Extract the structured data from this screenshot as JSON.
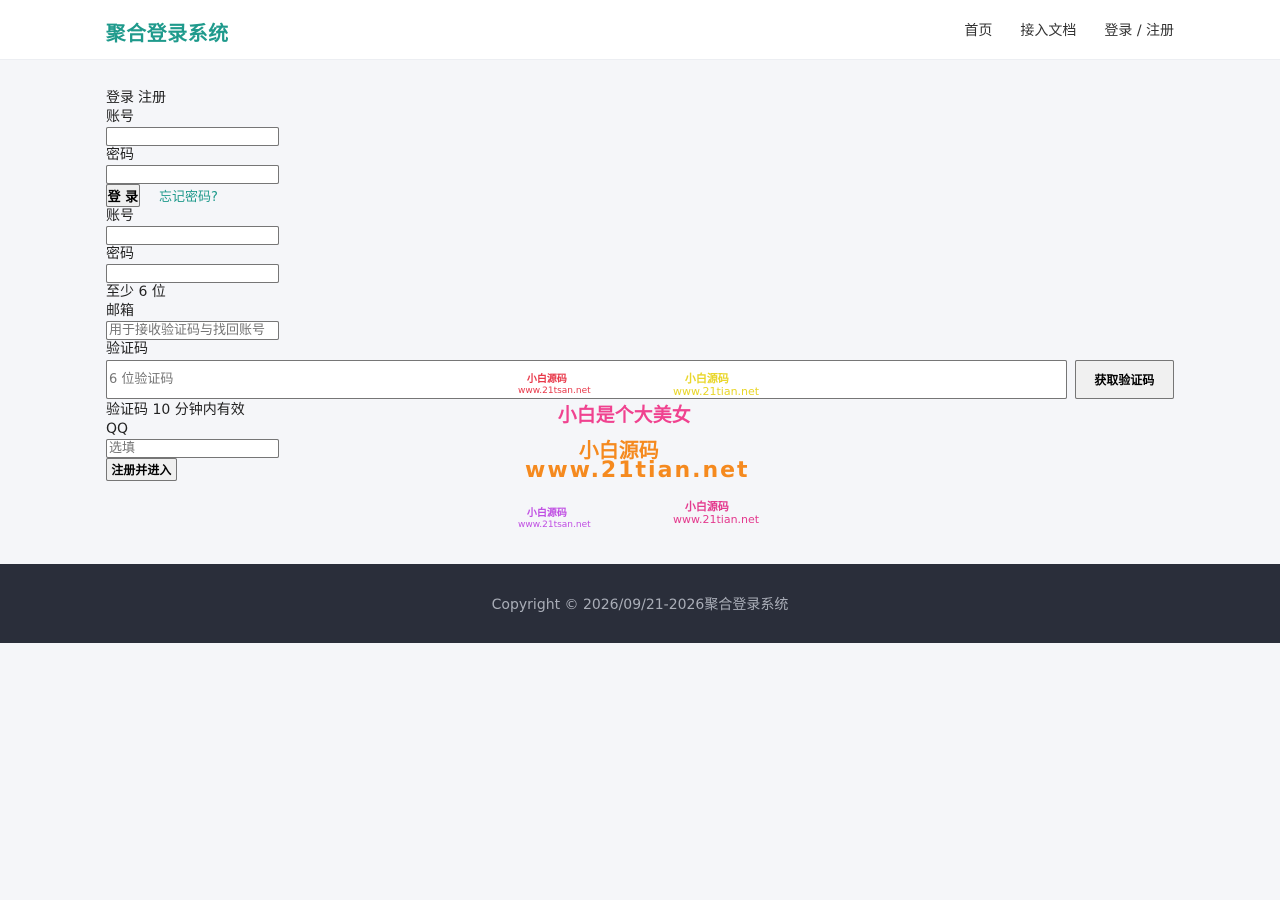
{
  "header": {
    "brand": "聚合登录系统",
    "nav": [
      "首页",
      "接入文档",
      "登录 / 注册"
    ]
  },
  "tabs": {
    "login": "登录",
    "register": "注册"
  },
  "login_form": {
    "account_label": "账号",
    "account_value": "",
    "password_label": "密码",
    "password_value": "",
    "submit_label": "登 录",
    "forgot_label": "忘记密码?"
  },
  "register_form": {
    "account_label": "账号",
    "account_value": "",
    "password_label": "密码",
    "password_value": "",
    "password_hint": "至少 6 位",
    "email_label": "邮箱",
    "email_placeholder": "用于接收验证码与找回账号",
    "code_label": "验证码",
    "code_placeholder": "6 位验证码",
    "code_button": "获取验证码",
    "code_hint": "验证码 10 分钟内有效",
    "qq_label": "QQ",
    "qq_placeholder": "选填",
    "submit_label": "注册并进入"
  },
  "watermark": {
    "line1a": "小白源码",
    "line1a_sub": "www.21tsan.net",
    "line1b": "小白源码",
    "line1b_sub": "www.21tian.net",
    "line2": "小白是个大美女",
    "line3": "小白源码",
    "line4": "www.21tian.net",
    "line5a": "小白源码",
    "line5a_sub": "www.21tsan.net",
    "line5b": "小白源码",
    "line5b_sub": "www.21tian.net"
  },
  "footer": {
    "copyright": "Copyright © 2026/09/21-2026聚合登录系统"
  },
  "colors": {
    "brand": "#1f9a8c",
    "footer_bg": "#2a2e3a",
    "page_bg": "#f5f6f9"
  }
}
